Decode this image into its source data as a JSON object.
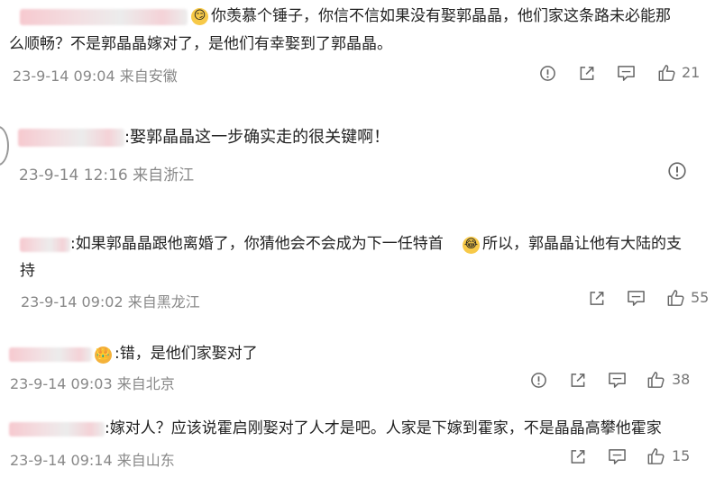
{
  "comments": [
    {
      "text_line1": "你羡慕个锤子，你信不信如果没有娶郭晶晶，他们家这条路未必能那",
      "text_line2": "么顺畅？不是郭晶晶嫁对了，是他们有幸娶到了郭晶晶。",
      "meta": "23-9-14 09:04 来自安徽",
      "likes": "21"
    },
    {
      "text_line1": ":娶郭晶晶这一步确实走的很关键啊！",
      "meta": "23-9-14 12:16 来自浙江"
    },
    {
      "text_line1": ":如果郭晶晶跟他离婚了，你猜他会不会成为下一任特首",
      "text_line1b": "所以，郭晶晶让他有大陆的支",
      "text_line2": "持",
      "meta": "23-9-14 09:02 来自黑龙江",
      "likes": "55"
    },
    {
      "text_line1": ":错，是他们家娶对了",
      "meta": "23-9-14 09:03 来自北京",
      "likes": "38"
    },
    {
      "text_line1": ":嫁对人？应该说霍启刚娶对了人才是吧。人家是下嫁到霍家，不是晶晶高攀他霍家",
      "meta": "23-9-14 09:14 来自山东",
      "likes": "15"
    }
  ],
  "icons": {
    "report": "report-icon",
    "share": "share-icon",
    "reply": "comment-icon",
    "like": "thumbs-up-icon"
  },
  "colors": {
    "text": "#222222",
    "meta": "#888888",
    "icon": "#666666"
  }
}
